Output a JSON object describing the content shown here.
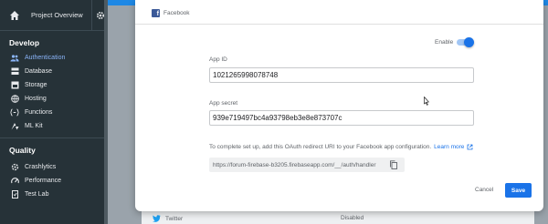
{
  "sidebar": {
    "project_label": "Project Overview",
    "sections": [
      {
        "title": "Develop",
        "items": [
          {
            "label": "Authentication",
            "icon": "users-icon",
            "active": true
          },
          {
            "label": "Database",
            "icon": "database-icon"
          },
          {
            "label": "Storage",
            "icon": "storage-icon"
          },
          {
            "label": "Hosting",
            "icon": "globe-icon"
          },
          {
            "label": "Functions",
            "icon": "functions-icon"
          },
          {
            "label": "ML Kit",
            "icon": "mlkit-icon"
          }
        ]
      },
      {
        "title": "Quality",
        "items": [
          {
            "label": "Crashlytics",
            "icon": "crashlytics-icon"
          },
          {
            "label": "Performance",
            "icon": "performance-icon"
          },
          {
            "label": "Test Lab",
            "icon": "testlab-icon"
          }
        ]
      }
    ]
  },
  "dialog": {
    "provider": "Facebook",
    "enable_label": "Enable",
    "enabled": true,
    "app_id_label": "App ID",
    "app_id_value": "1021265998078748",
    "app_secret_label": "App secret",
    "app_secret_value": "939e719497bc4a93798eb3e8e873707c",
    "info_text": "To complete set up, add this OAuth redirect URI to your Facebook app configuration.",
    "learn_more": "Learn more",
    "redirect_uri": "https://forum-firebase-b3205.firebaseapp.com/__/auth/handler",
    "cancel_label": "Cancel",
    "save_label": "Save"
  },
  "background": {
    "row_label": "Twitter",
    "row_status": "Disabled"
  },
  "colors": {
    "sidebar_bg": "#263238",
    "accent": "#1a73e8",
    "active_item": "#8ab4f8"
  }
}
